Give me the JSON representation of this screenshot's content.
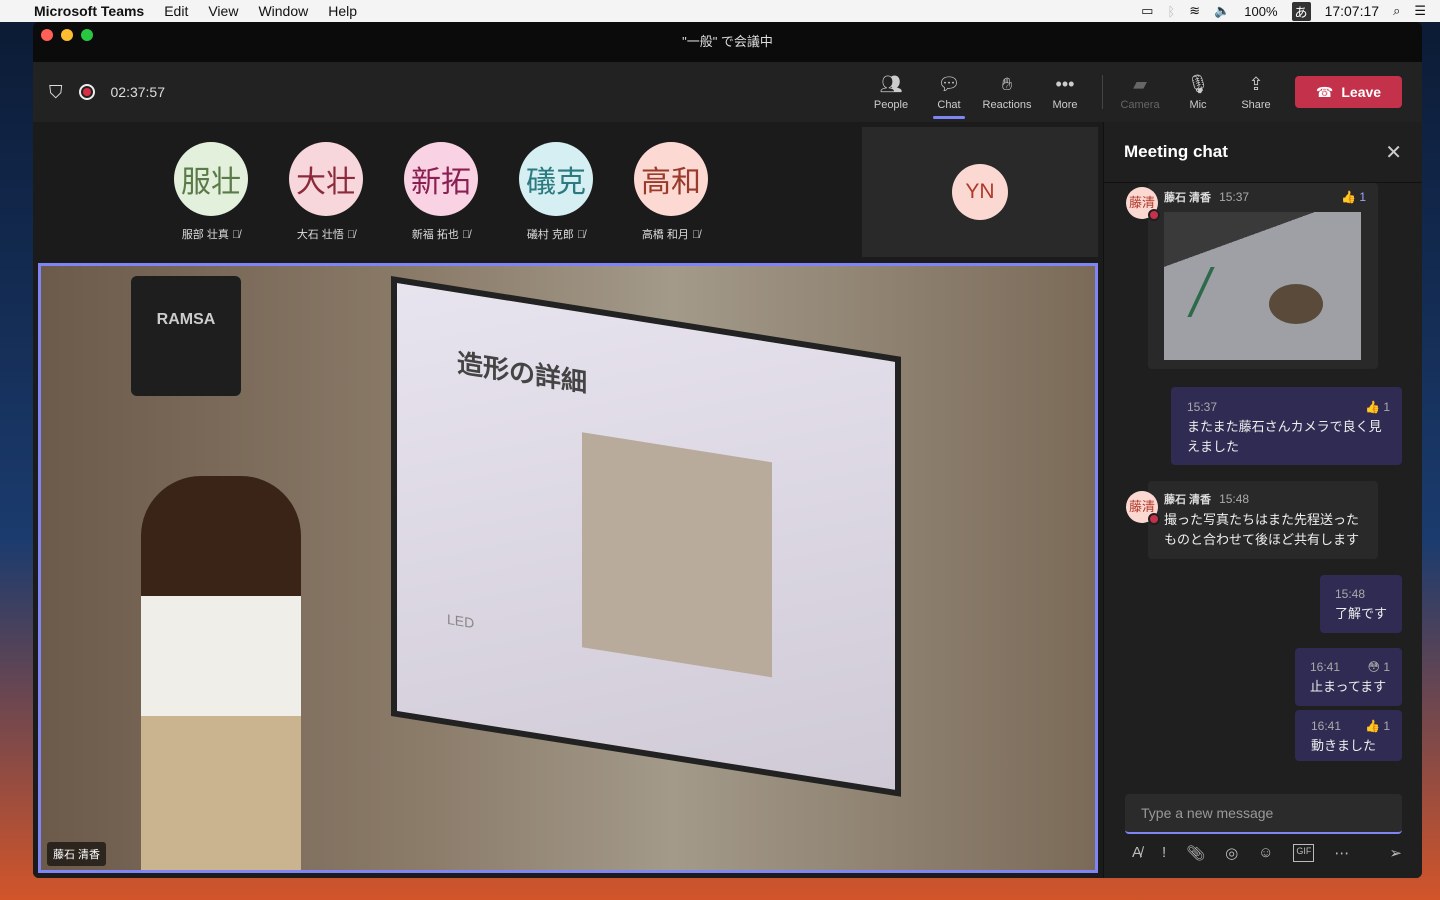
{
  "menubar": {
    "app": "Microsoft Teams",
    "items": [
      "Edit",
      "View",
      "Window",
      "Help"
    ],
    "battery": "100%",
    "ime": "あ",
    "clock": "17:07:17"
  },
  "window": {
    "title": "\"一般\" で会議中"
  },
  "toolbar": {
    "timer": "02:37:57",
    "buttons": {
      "people": "People",
      "chat": "Chat",
      "reactions": "Reactions",
      "more": "More",
      "camera": "Camera",
      "mic": "Mic",
      "share": "Share"
    },
    "leave": "Leave"
  },
  "participants": [
    {
      "initials": "服壮",
      "name": "服部 壮真",
      "bg": "#e3f0dc",
      "fg": "#5a7a48"
    },
    {
      "initials": "大壮",
      "name": "大石 壮悟",
      "bg": "#f8d7dc",
      "fg": "#8a2a3a"
    },
    {
      "initials": "新拓",
      "name": "新福 拓也",
      "bg": "#f9d3e4",
      "fg": "#8a1f52"
    },
    {
      "initials": "礒克",
      "name": "礒村 克郎",
      "bg": "#d6eff2",
      "fg": "#2a7a80"
    },
    {
      "initials": "高和",
      "name": "高橋 和月",
      "bg": "#fcdad3",
      "fg": "#9a3a2a"
    }
  ],
  "self_tile": {
    "initials": "YN"
  },
  "video": {
    "speaker_label": "藤石 清香",
    "slide_title": "造形の詳細",
    "speaker_brand": "RAMSA",
    "slide_text": "LED"
  },
  "chat": {
    "title": "Meeting chat",
    "messages": [
      {
        "avatar": "藤清",
        "sender": "藤石 清香",
        "time": "15:37",
        "reaction": "1"
      },
      {
        "time": "15:37",
        "text": "またまた藤石さんカメラで良く見えました",
        "reaction": "1"
      },
      {
        "avatar": "藤清",
        "sender": "藤石 清香",
        "time": "15:48",
        "text": "撮った写真たちはまた先程送ったものと合わせて後ほど共有します"
      },
      {
        "time": "15:48",
        "text": "了解です"
      },
      {
        "time": "16:41",
        "text": "止まってます",
        "reaction": "1"
      },
      {
        "time": "16:41",
        "text": "動きました",
        "reaction": "1"
      }
    ],
    "placeholder": "Type a new message"
  }
}
